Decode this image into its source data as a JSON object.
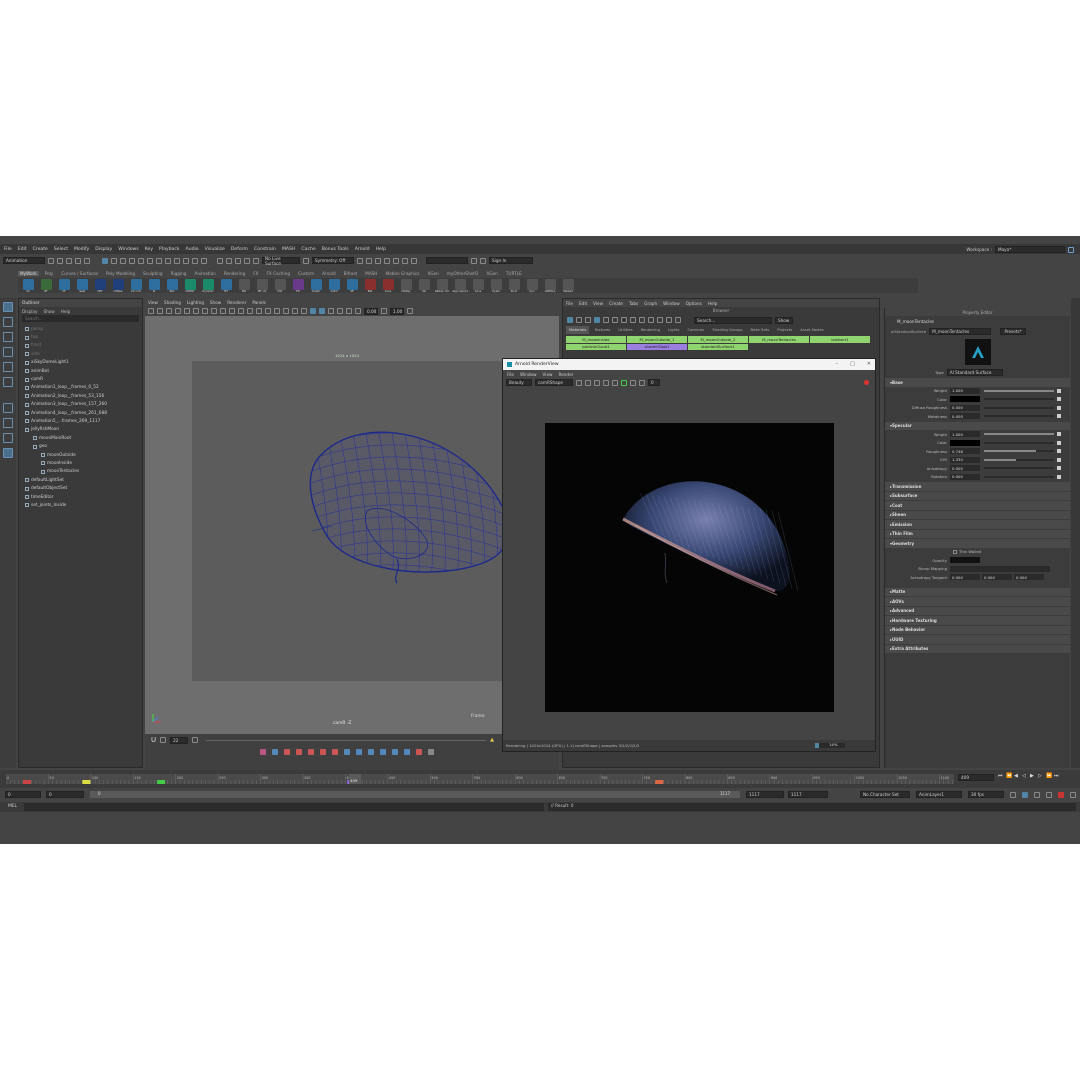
{
  "menubar": {
    "items": [
      "File",
      "Edit",
      "Create",
      "Select",
      "Modify",
      "Display",
      "Windows",
      "Key",
      "Playback",
      "Audio",
      "Visualize",
      "Deform",
      "Constrain",
      "MASH",
      "Cache",
      "Bonus Tools",
      "Arnold",
      "Help"
    ],
    "workspace_label": "Workspace :",
    "workspace_value": "Maya*"
  },
  "statusline": {
    "menuset": "Animation",
    "live_surface": "No Live Surface",
    "symmetry": "Symmetry: Off",
    "signin": "Sign In"
  },
  "shelf": {
    "tabs": [
      "MyWork",
      "Poly",
      "Curves / Surfaces",
      "Poly Modeling",
      "Sculpting",
      "Rigging",
      "Animation",
      "Rendering",
      "FX",
      "FX Caching",
      "Custom",
      "Arnold",
      "Bifrost",
      "MASH",
      "Motion Graphics",
      "XGen",
      "myOtherShelf2",
      "XGen",
      "TURTLE"
    ],
    "active_tab": 0,
    "labels": [
      "VA",
      "RT",
      "CF",
      "reset",
      "OPT",
      "CTRLw",
      "CV->CV",
      "IK",
      "Rbz",
      "CONST",
      "Dynamic",
      "MT",
      "MR",
      "MT->R",
      "MLT",
      "ED",
      "Graph",
      "CoEd",
      "SE",
      "Bat",
      "Cons",
      "CR/Key",
      "Val",
      "Ribbon ctrl",
      "dsgn export",
      "Cons",
      "Eyebl",
      "B+O",
      "Dyn",
      "OVERLA",
      "Marked"
    ]
  },
  "outliner": {
    "title": "Outliner",
    "menu": [
      "Display",
      "Show",
      "Help"
    ],
    "search_placeholder": "Search...",
    "items": [
      {
        "label": "persp",
        "dim": true
      },
      {
        "label": "top",
        "dim": true
      },
      {
        "label": "front",
        "dim": true
      },
      {
        "label": "side",
        "dim": true
      },
      {
        "label": "aiSkyDomeLight1",
        "dim": false
      },
      {
        "label": "animBot",
        "dim": false
      },
      {
        "label": "camR",
        "dim": false
      },
      {
        "label": "Animation1_loop__frames_0_52",
        "dim": false
      },
      {
        "label": "Animation2_loop__frames_53_156",
        "dim": false
      },
      {
        "label": "Animation3_loop__frames_157_260",
        "dim": false
      },
      {
        "label": "Animation4_loop__frames_261_688",
        "dim": false
      },
      {
        "label": "Animation5_...frames_269_1117",
        "dim": false
      },
      {
        "label": "jellyfishMoon",
        "dim": false
      },
      {
        "label": "moonMainRoot",
        "dim": false
      },
      {
        "label": "geo",
        "dim": false
      },
      {
        "label": "moonOutside",
        "dim": false
      },
      {
        "label": "moonInside",
        "dim": false
      },
      {
        "label": "moonTentacles",
        "dim": false
      },
      {
        "label": "defaultLightSet",
        "dim": false
      },
      {
        "label": "defaultObjectSet",
        "dim": false
      },
      {
        "label": "timeEditor",
        "dim": false
      },
      {
        "label": "set_joints_Inside",
        "dim": false
      }
    ]
  },
  "viewport": {
    "menu": [
      "View",
      "Shading",
      "Lighting",
      "Show",
      "Renderer",
      "Panels"
    ],
    "resolution": "1024 x 1024",
    "camera": "camR -Z",
    "frame_label": "Frame:",
    "exposure": "0.00",
    "gamma": "1.00",
    "gate_value": "22"
  },
  "hypershade": {
    "menu": [
      "File",
      "Edit",
      "View",
      "Create",
      "Tabs",
      "Graph",
      "Window",
      "Options",
      "Help"
    ],
    "browser_label": "Browser",
    "search_placeholder": "Search...",
    "show_label": "Show",
    "tabs": [
      "Materials",
      "Textures",
      "Utilities",
      "Rendering",
      "Lights",
      "Cameras",
      "Shading Groups",
      "Bake Sets",
      "Projects",
      "Asset Nodes"
    ],
    "materials": [
      {
        "label": "M_moonInside",
        "color": "#8fd46f"
      },
      {
        "label": "M_moonOutside_1",
        "color": "#8fd46f"
      },
      {
        "label": "M_moonOutside_2",
        "color": "#8fd46f"
      },
      {
        "label": "M_moonTentacles",
        "color": "#8fd46f"
      },
      {
        "label": "lambert1",
        "color": "#8fd46f"
      },
      {
        "label": "particleCloud1",
        "color": "#8fd46f"
      },
      {
        "label": "shaderGlow1",
        "color": "#9b7fe0"
      },
      {
        "label": "standardSurface1",
        "color": "#8fd46f"
      }
    ]
  },
  "renderview": {
    "title": "Arnold RenderView",
    "menu": [
      "File",
      "Window",
      "View",
      "Render"
    ],
    "aov": "Beauty",
    "camera": "camRShape",
    "zoom_value": "0",
    "status": "Rendering | 1024x1024 (GPU) | 1.1| camRShape | samples 3/2/2/2/2/2",
    "progress": "14%"
  },
  "property_editor": {
    "title": "Property Editor",
    "node_name": "M_moonTentacles",
    "node_type": "aiStandardSurface",
    "node_field": "M_moonTentacles",
    "presets": "Presets*",
    "type_label": "Type",
    "type_value": "AI Standard Surface",
    "sections": {
      "base": {
        "title": "Base",
        "rows": [
          {
            "label": "Weight",
            "value": "1.000",
            "fill": 1.0
          },
          {
            "label": "Color",
            "value": "",
            "fill": 0
          },
          {
            "label": "Diffuse Roughness",
            "value": "0.000",
            "fill": 0.0
          },
          {
            "label": "Metalness",
            "value": "0.000",
            "fill": 0.0
          }
        ]
      },
      "specular": {
        "title": "Specular",
        "rows": [
          {
            "label": "Weight",
            "value": "1.000",
            "fill": 1.0
          },
          {
            "label": "Color",
            "value": "",
            "fill": 0
          },
          {
            "label": "Roughness",
            "value": "0.746",
            "fill": 0.746
          },
          {
            "label": "IOR",
            "value": "1.330",
            "fill": 0.45
          },
          {
            "label": "Anisotropy",
            "value": "0.000",
            "fill": 0.0
          },
          {
            "label": "Rotation",
            "value": "0.000",
            "fill": 0.0
          }
        ]
      },
      "collapsed": [
        "Transmission",
        "Subsurface",
        "Coat",
        "Sheen",
        "Emission",
        "Thin Film"
      ],
      "geometry": {
        "title": "Geometry",
        "thin_walled": "Thin Walled",
        "opacity_label": "Opacity",
        "bump_label": "Bump Mapping",
        "aniso_label": "Anisotropy Tangent",
        "aniso_values": [
          "0.000",
          "0.000",
          "0.000"
        ]
      },
      "collapsed2": [
        "Matte",
        "AOVs",
        "Advanced",
        "Hardware Texturing",
        "Node Behavior",
        "UUID",
        "Extra Attributes"
      ]
    }
  },
  "timeline": {
    "current_frame": "409",
    "ticks": [
      "0",
      "50",
      "100",
      "150",
      "200",
      "250",
      "300",
      "350",
      "400",
      "450",
      "500",
      "550",
      "600",
      "650",
      "700",
      "750",
      "800",
      "850",
      "900",
      "950",
      "1000",
      "1050",
      "1100"
    ],
    "frame_field": "409"
  },
  "range": {
    "start": "0",
    "start_inner": "0",
    "end_inner": "1117",
    "end": "1117",
    "end2": "1117",
    "character_set": "No Character Set",
    "anim_layer": "AnimLayer1",
    "fps": "30 fps"
  },
  "cmdline": {
    "lang": "MEL",
    "result": "// Result: 0"
  },
  "colors": {
    "accent_blue": "#5285a6",
    "material_green": "#8fd46f",
    "material_purple": "#9b7fe0",
    "wire_blue": "#1d2a8a"
  }
}
